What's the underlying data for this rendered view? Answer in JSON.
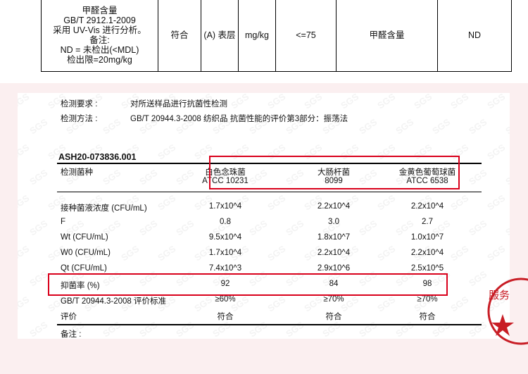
{
  "top_table": {
    "col1_lines": [
      "甲醛含量",
      "GB/T 2912.1-2009",
      "采用 UV-Vis 进行分析。",
      "备注:",
      "ND = 未检出(<MDL)",
      "检出限=20mg/kg"
    ],
    "col2": "符合",
    "col3": "(A) 表层",
    "col4": "mg/kg",
    "col5": "<=75",
    "col6": "甲醛含量",
    "col7": "ND"
  },
  "report": {
    "requirement_label": "检测要求 :",
    "requirement_value": "对所送样品进行抗菌性检测",
    "method_label": "检测方法 :",
    "method_value": "GB/T 20944.3-2008 纺织品 抗菌性能的评价第3部分：振荡法",
    "sample_id": "ASH20-073836.001",
    "header_label": "检测菌种",
    "bacteria": [
      {
        "name": "白色念珠菌",
        "code": "ATCC 10231"
      },
      {
        "name": "大肠杆菌",
        "code": "8099"
      },
      {
        "name": "金黄色葡萄球菌",
        "code": "ATCC 6538"
      }
    ],
    "rows": [
      {
        "label": "接种菌液浓度 (CFU/mL)",
        "values": [
          "1.7x10^4",
          "2.2x10^4",
          "2.2x10^4"
        ]
      },
      {
        "label": "F",
        "values": [
          "0.8",
          "3.0",
          "2.7"
        ]
      },
      {
        "label": "Wt (CFU/mL)",
        "values": [
          "9.5x10^4",
          "1.8x10^7",
          "1.0x10^7"
        ]
      },
      {
        "label": "W0 (CFU/mL)",
        "values": [
          "1.7x10^4",
          "2.2x10^4",
          "2.2x10^4"
        ]
      },
      {
        "label": "Qt  (CFU/mL)",
        "values": [
          "7.4x10^3",
          "2.9x10^6",
          "2.5x10^5"
        ]
      },
      {
        "label": "抑菌率 (%)",
        "values": [
          "92",
          "84",
          "98"
        ]
      },
      {
        "label": "GB/T 20944.3-2008 评价标准",
        "values": [
          "≥60%",
          "≥70%",
          "≥70%"
        ]
      },
      {
        "label": "评价",
        "values": [
          "符合",
          "符合",
          "符合"
        ]
      }
    ],
    "remarks_label": "备注 :"
  },
  "seal": {
    "text": "服务"
  },
  "colors": {
    "highlight_red": "#d9001b",
    "background_pink": "#fbeff0"
  }
}
